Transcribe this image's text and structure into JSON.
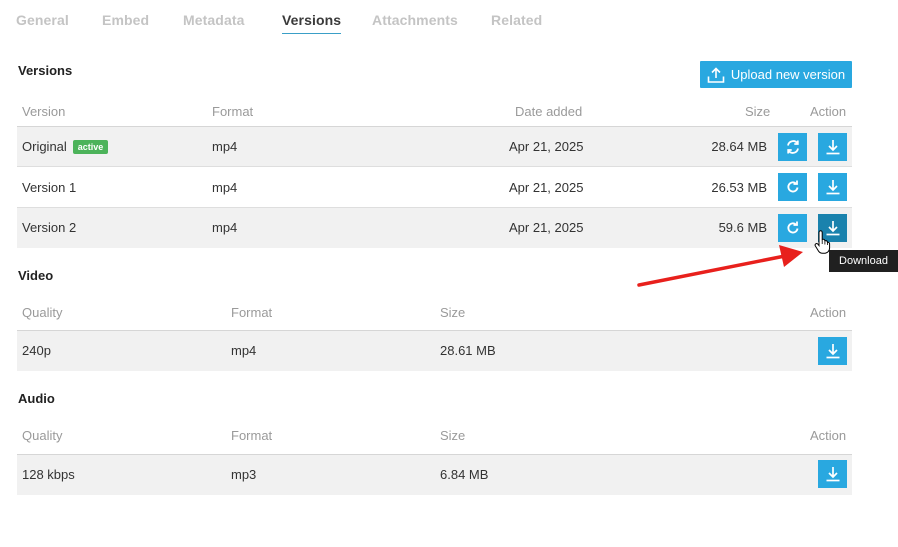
{
  "tabs": [
    {
      "label": "General",
      "active": false
    },
    {
      "label": "Embed",
      "active": false
    },
    {
      "label": "Metadata",
      "active": false
    },
    {
      "label": "Versions",
      "active": true
    },
    {
      "label": "Attachments",
      "active": false
    },
    {
      "label": "Related",
      "active": false
    }
  ],
  "versions": {
    "title": "Versions",
    "upload_label": "Upload new version",
    "headers": {
      "version": "Version",
      "format": "Format",
      "date": "Date added",
      "size": "Size",
      "action": "Action"
    },
    "rows": [
      {
        "version": "Original",
        "badge": "active",
        "format": "mp4",
        "date": "Apr 21, 2025",
        "size": "28.64 MB"
      },
      {
        "version": "Version 1",
        "format": "mp4",
        "date": "Apr 21, 2025",
        "size": "26.53 MB"
      },
      {
        "version": "Version 2",
        "format": "mp4",
        "date": "Apr 21, 2025",
        "size": "59.6 MB"
      }
    ]
  },
  "video": {
    "title": "Video",
    "headers": {
      "quality": "Quality",
      "format": "Format",
      "size": "Size",
      "action": "Action"
    },
    "rows": [
      {
        "quality": "240p",
        "format": "mp4",
        "size": "28.61 MB"
      }
    ]
  },
  "audio": {
    "title": "Audio",
    "headers": {
      "quality": "Quality",
      "format": "Format",
      "size": "Size",
      "action": "Action"
    },
    "rows": [
      {
        "quality": "128 kbps",
        "format": "mp3",
        "size": "6.84 MB"
      }
    ]
  },
  "tooltip": "Download",
  "icons": {
    "upload": "upload-icon",
    "replace_spinning": "sync-icon",
    "replace": "refresh-icon",
    "download": "download-icon",
    "cursor": "hand-cursor-icon"
  },
  "colors": {
    "accent": "#29a8e0",
    "accent_hover": "#1a82ad",
    "badge": "#4cb35a",
    "annotation_arrow": "#e8201c",
    "tooltip_bg": "#202020"
  }
}
